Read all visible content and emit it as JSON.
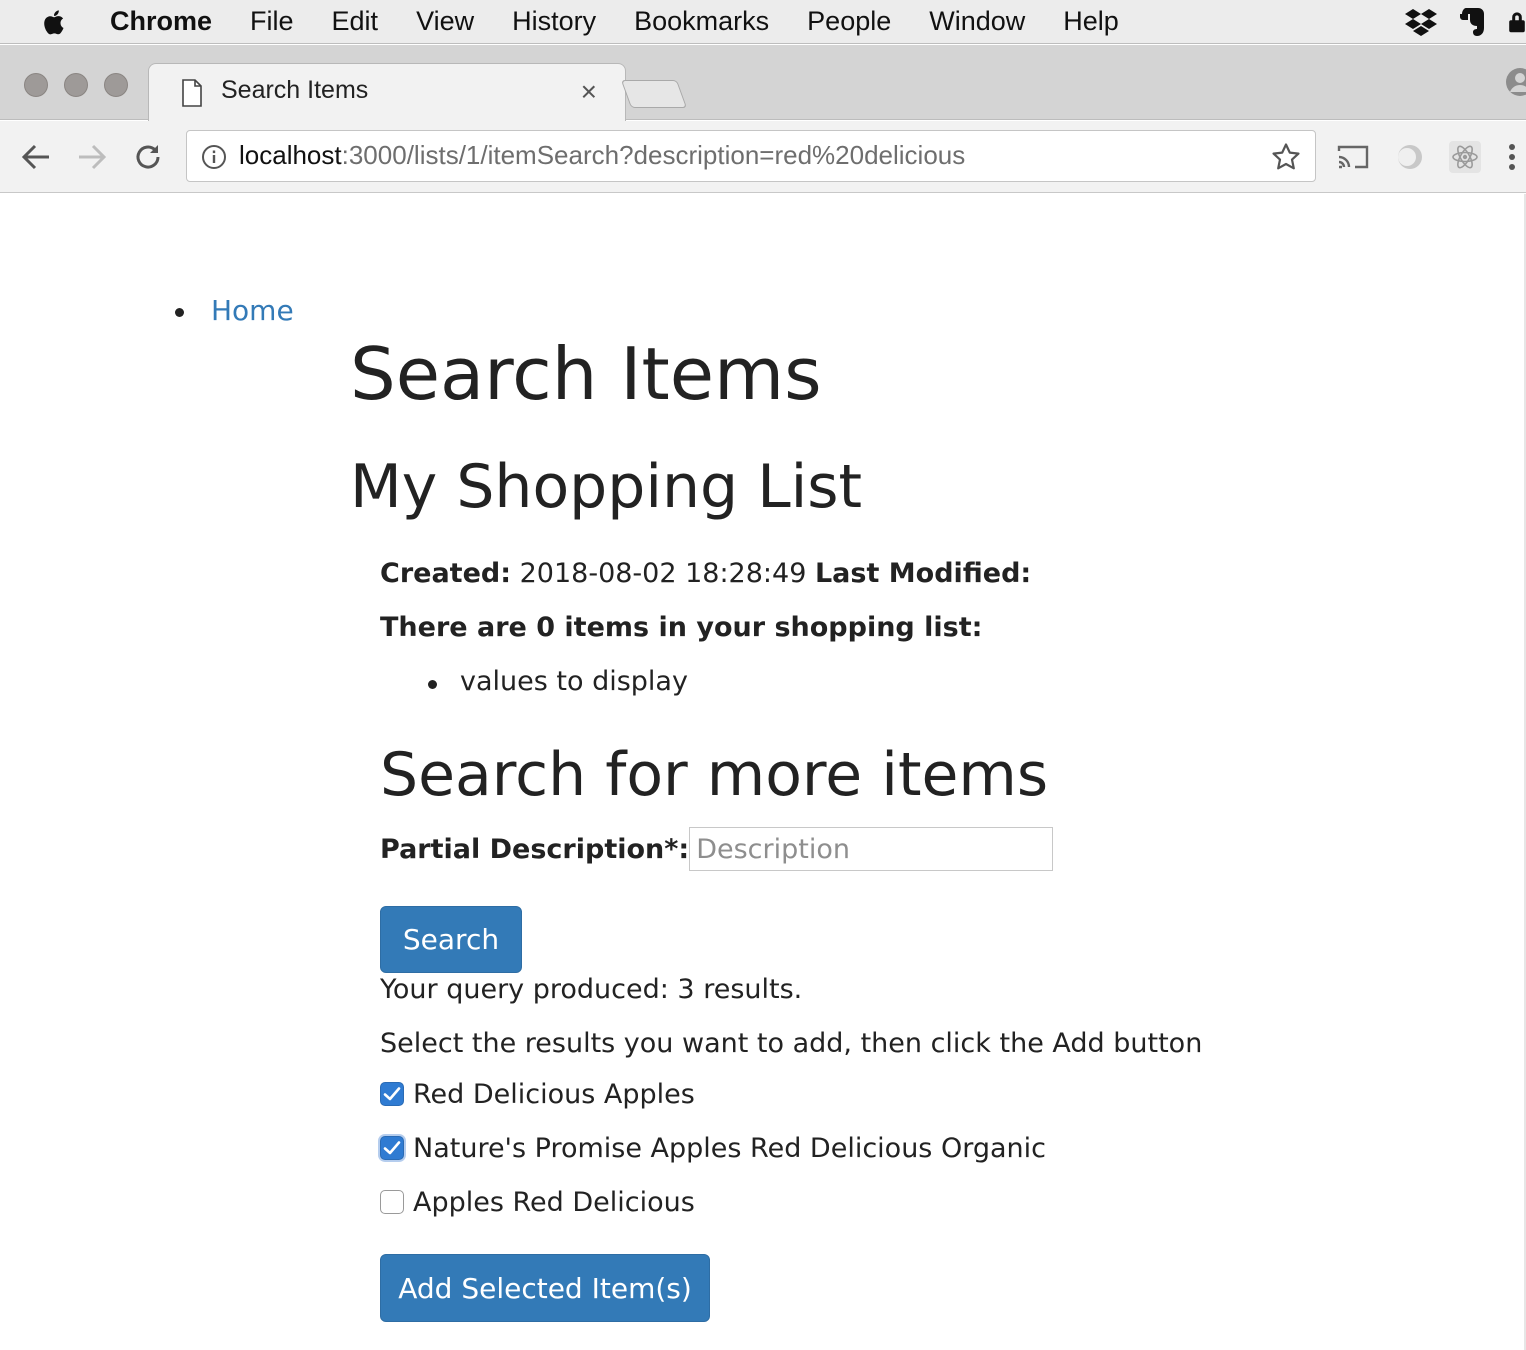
{
  "os_menu": {
    "app_name": "Chrome",
    "items": [
      "File",
      "Edit",
      "View",
      "History",
      "Bookmarks",
      "People",
      "Window",
      "Help"
    ],
    "tray_icons": [
      "dropbox-icon",
      "evernote-icon",
      "lock-icon"
    ]
  },
  "browser": {
    "tab": {
      "title": "Search Items",
      "close_glyph": "×"
    },
    "url": {
      "host": "localhost",
      "path": ":3000/lists/1/itemSearch?description=red%20delicious"
    },
    "extension_icons": [
      "cast-icon",
      "extension-circle-icon",
      "react-devtools-icon",
      "menu-kebab-icon"
    ]
  },
  "page": {
    "nav": {
      "home_label": "Home"
    },
    "title": "Search Items",
    "list_name": "My Shopping List",
    "meta": {
      "created_label": "Created:",
      "created_value": "2018-08-02 18:28:49",
      "modified_label": "Last Modified:"
    },
    "item_count_text": "There are 0 items in your shopping list:",
    "items": [
      "values to display"
    ],
    "search_heading": "Search for more items",
    "search": {
      "label": "Partial Description*:",
      "placeholder": "Description",
      "value": "",
      "button_label": "Search"
    },
    "query_result": "Your query produced: 3 results.",
    "instructions": "Select the results you want to add, then click the Add button",
    "results": [
      {
        "label": "Red Delicious Apples",
        "checked": true
      },
      {
        "label": "Nature's Promise Apples Red Delicious Organic",
        "checked": true
      },
      {
        "label": "Apples Red Delicious",
        "checked": false
      }
    ],
    "add_button_label": "Add Selected Item(s)"
  },
  "colors": {
    "link": "#337ab7",
    "primary_button": "#337ab7",
    "checkbox_checked": "#2f7bd2"
  }
}
